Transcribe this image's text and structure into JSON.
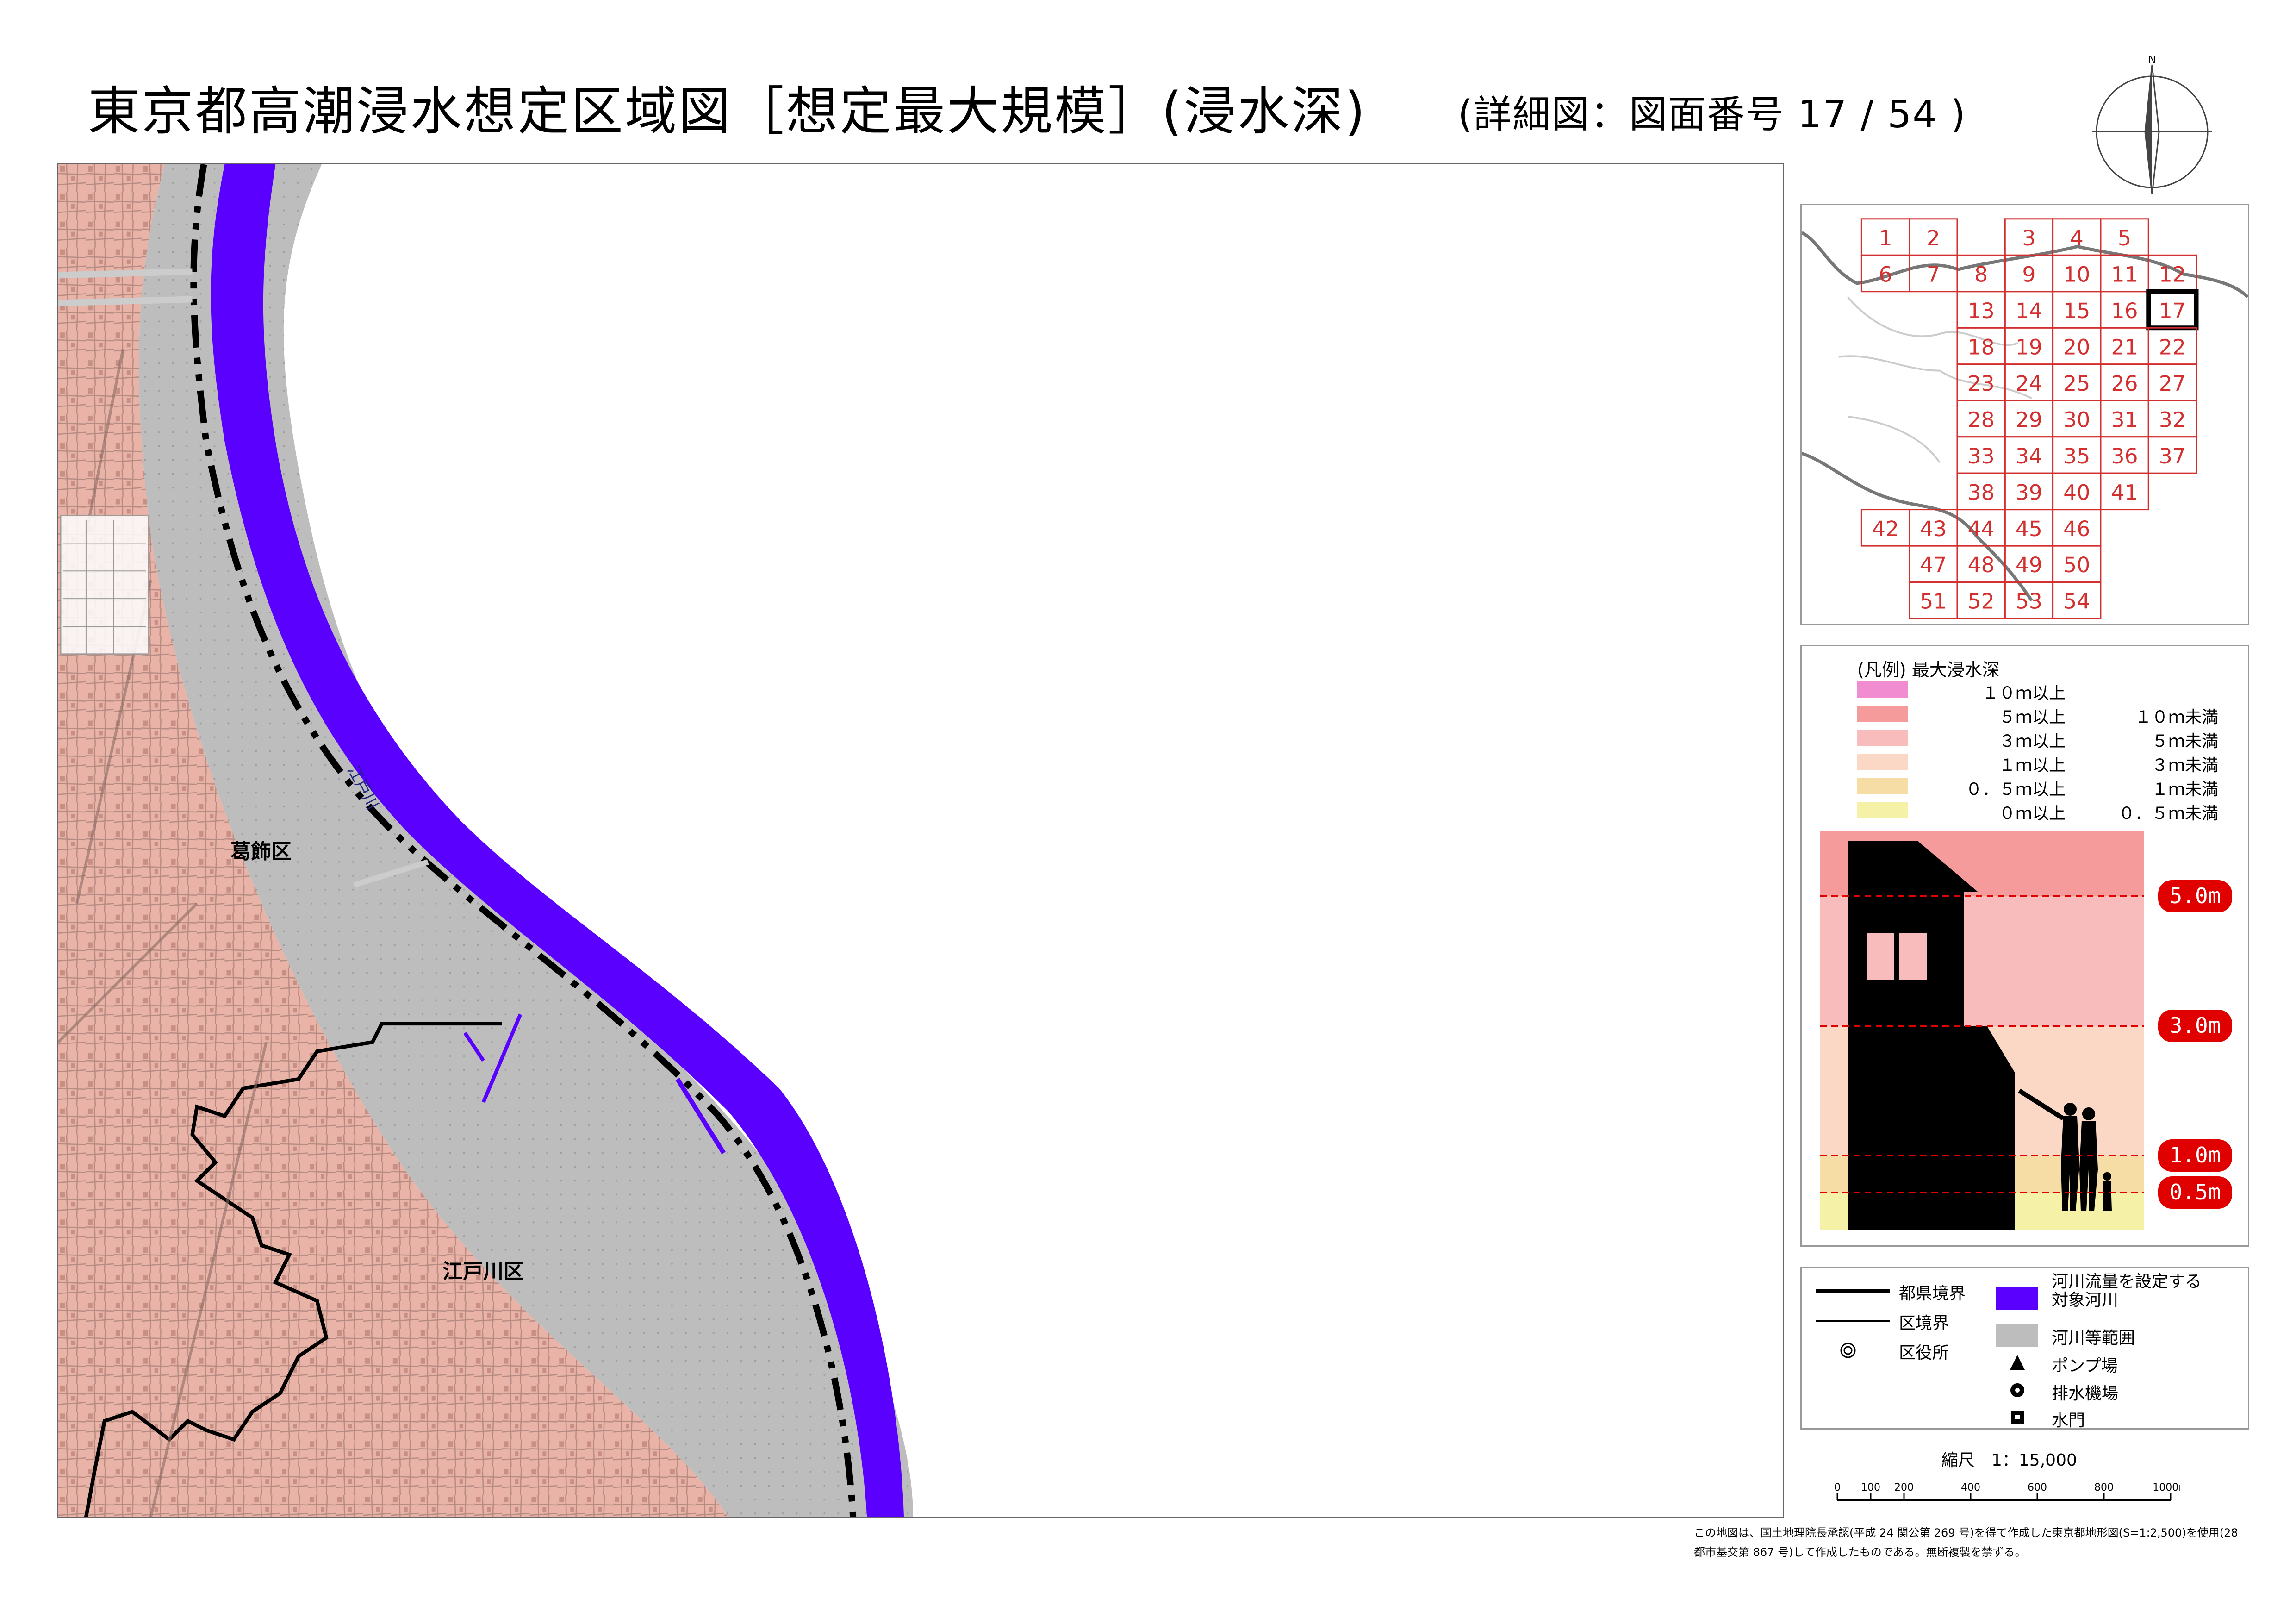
{
  "header": {
    "title": "東京都高潮浸水想定区域図［想定最大規模］(浸水深)",
    "subtitle": "(詳細図：図面番号 17 / 54 )"
  },
  "compass": {
    "north_label": "N"
  },
  "map": {
    "labels": {
      "ward_katsushika": "葛飾区",
      "ward_edogawa": "江戸川区",
      "river_name": "江戸川"
    },
    "colors": {
      "river": "#5a00ff",
      "river_area": "#bdbdbd",
      "urban_flood": "#e9b3a8",
      "ward_boundary": "#000000",
      "prefecture_boundary": "#000000"
    }
  },
  "index_map": {
    "grid_color": "#d32f2f",
    "current_sheet": "17",
    "rows": [
      {
        "cells": [
          {
            "c": 1,
            "n": "1"
          },
          {
            "c": 2,
            "n": "2"
          },
          {
            "c": 4,
            "n": "3"
          },
          {
            "c": 5,
            "n": "4"
          },
          {
            "c": 6,
            "n": "5"
          }
        ]
      },
      {
        "cells": [
          {
            "c": 1,
            "n": "6"
          },
          {
            "c": 2,
            "n": "7"
          },
          {
            "c": 3,
            "n": "8"
          },
          {
            "c": 4,
            "n": "9"
          },
          {
            "c": 5,
            "n": "10"
          },
          {
            "c": 6,
            "n": "11"
          },
          {
            "c": 7,
            "n": "12"
          }
        ]
      },
      {
        "cells": [
          {
            "c": 3,
            "n": "13"
          },
          {
            "c": 4,
            "n": "14"
          },
          {
            "c": 5,
            "n": "15"
          },
          {
            "c": 6,
            "n": "16"
          },
          {
            "c": 7,
            "n": "17"
          }
        ]
      },
      {
        "cells": [
          {
            "c": 3,
            "n": "18"
          },
          {
            "c": 4,
            "n": "19"
          },
          {
            "c": 5,
            "n": "20"
          },
          {
            "c": 6,
            "n": "21"
          },
          {
            "c": 7,
            "n": "22"
          }
        ]
      },
      {
        "cells": [
          {
            "c": 3,
            "n": "23"
          },
          {
            "c": 4,
            "n": "24"
          },
          {
            "c": 5,
            "n": "25"
          },
          {
            "c": 6,
            "n": "26"
          },
          {
            "c": 7,
            "n": "27"
          }
        ]
      },
      {
        "cells": [
          {
            "c": 3,
            "n": "28"
          },
          {
            "c": 4,
            "n": "29"
          },
          {
            "c": 5,
            "n": "30"
          },
          {
            "c": 6,
            "n": "31"
          },
          {
            "c": 7,
            "n": "32"
          }
        ]
      },
      {
        "cells": [
          {
            "c": 3,
            "n": "33"
          },
          {
            "c": 4,
            "n": "34"
          },
          {
            "c": 5,
            "n": "35"
          },
          {
            "c": 6,
            "n": "36"
          },
          {
            "c": 7,
            "n": "37"
          }
        ]
      },
      {
        "cells": [
          {
            "c": 3,
            "n": "38"
          },
          {
            "c": 4,
            "n": "39"
          },
          {
            "c": 5,
            "n": "40"
          },
          {
            "c": 6,
            "n": "41"
          }
        ]
      },
      {
        "cells": [
          {
            "c": 1,
            "n": "42"
          },
          {
            "c": 2,
            "n": "43"
          },
          {
            "c": 3,
            "n": "44"
          },
          {
            "c": 4,
            "n": "45"
          },
          {
            "c": 5,
            "n": "46"
          }
        ]
      },
      {
        "cells": [
          {
            "c": 2,
            "n": "47"
          },
          {
            "c": 3,
            "n": "48"
          },
          {
            "c": 4,
            "n": "49"
          },
          {
            "c": 5,
            "n": "50"
          }
        ]
      },
      {
        "cells": [
          {
            "c": 2,
            "n": "51"
          },
          {
            "c": 3,
            "n": "52"
          },
          {
            "c": 4,
            "n": "53"
          },
          {
            "c": 5,
            "n": "54"
          }
        ]
      }
    ]
  },
  "legend": {
    "title": "(凡例) 最大浸水深",
    "items": [
      {
        "color": "#f08ccf",
        "lower": "１０ｍ以上",
        "upper": ""
      },
      {
        "color": "#f59b9b",
        "lower": "５ｍ以上",
        "upper": "１０ｍ未満"
      },
      {
        "color": "#f8bcbc",
        "lower": "３ｍ以上",
        "upper": "５ｍ未満"
      },
      {
        "color": "#fbd8c6",
        "lower": "１ｍ以上",
        "upper": "３ｍ未満"
      },
      {
        "color": "#f6dca5",
        "lower": "０．５ｍ以上",
        "upper": "１ｍ未満"
      },
      {
        "color": "#f5f2a8",
        "lower": "０ｍ以上",
        "upper": "０．５ｍ未満"
      }
    ],
    "depth_markers": [
      "5.0m",
      "3.0m",
      "1.0m",
      "0.5m"
    ]
  },
  "symbols": {
    "prefecture_boundary": "都県境界",
    "ward_boundary": "区境界",
    "ward_office": "区役所",
    "target_river": "河川流量を設定する\n対象河川",
    "river_area": "河川等範囲",
    "pump_station": "ポンプ場",
    "drainage_station": "排水機場",
    "floodgate": "水門",
    "icons": {
      "ward_office": "double-circle-icon",
      "pump_station": "triangle-icon",
      "drainage_station": "dotted-circle-icon",
      "floodgate": "square-dot-icon"
    }
  },
  "scale": {
    "label": "縮尺　1：15,000",
    "ticks": [
      "0",
      "100",
      "200",
      "400",
      "600",
      "800",
      "1000m"
    ],
    "tick_values": [
      0,
      100,
      200,
      400,
      600,
      800,
      1000
    ]
  },
  "credit": "この地図は、国土地理院長承認(平成 24 関公第 269 号)を得て作成した東京都地形図(S=1:2,500)を使用(28 都市基交第 867 号)して作成したものである。無断複製を禁ずる。"
}
